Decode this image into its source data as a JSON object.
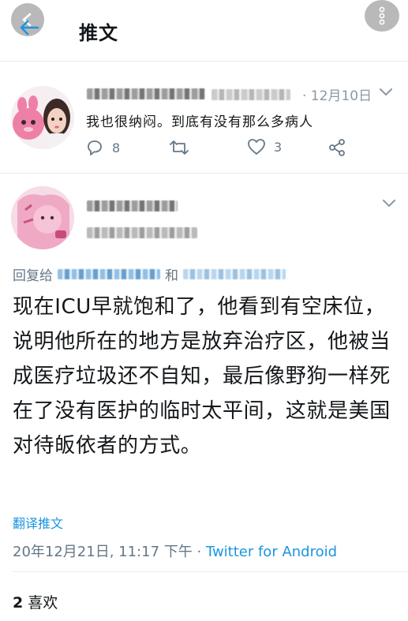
{
  "header": {
    "title": "推文"
  },
  "tweet1": {
    "date": "· 12月10日",
    "text": "我也很纳闷。到底有没有那么多病人",
    "replies": "8",
    "likes": "3"
  },
  "tweet2": {
    "reply_prefix": "回复给",
    "reply_and": "和",
    "text": "现在ICU早就饱和了，他看到有空床位，说明他所在的地方是放弃治疗区，他被当成医疗垃圾还不自知，最后像野狗一样死在了没有医护的临时太平间，这就是美国对待皈依者的方式。",
    "translate_label": "翻译推文",
    "timestamp": "20年12月21日, 11:17 下午 · ",
    "source": "Twitter for Android",
    "like_count": "2",
    "like_label": "喜欢"
  },
  "colors": {
    "accent": "#1b95e0",
    "muted": "#657786",
    "text": "#14171a"
  },
  "icons": [
    "back-arrow-icon",
    "more-vertical-icon",
    "chevron-down-icon",
    "reply-icon",
    "retweet-icon",
    "like-icon",
    "share-icon"
  ]
}
